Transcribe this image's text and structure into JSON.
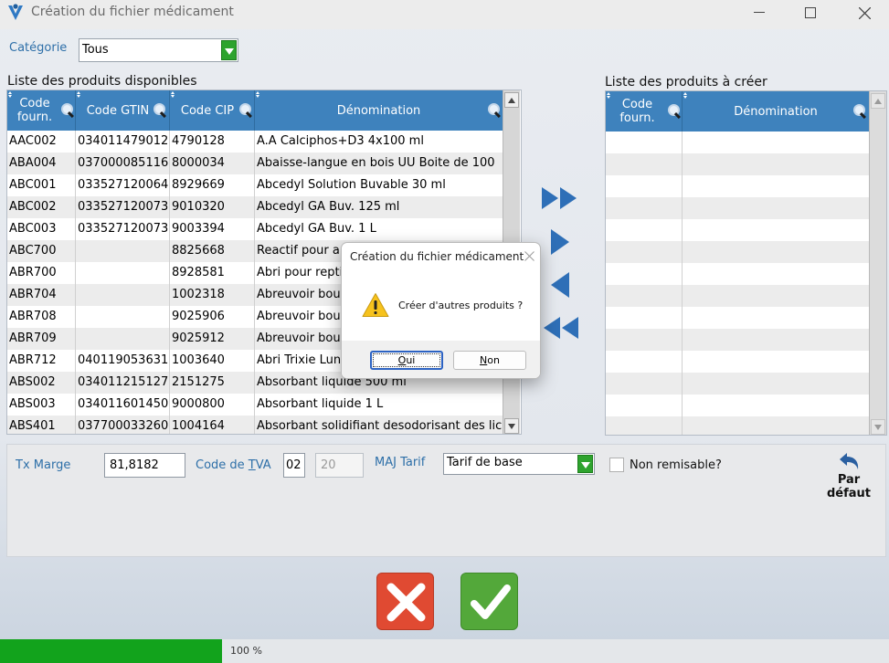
{
  "window": {
    "title": "Création du fichier médicament",
    "minimize_icon": "minimize-icon",
    "maximize_icon": "maximize-icon",
    "close_icon": "close-icon"
  },
  "category": {
    "label": "Catégorie",
    "value": "Tous"
  },
  "available": {
    "title": "Liste des produits disponibles",
    "headers": [
      "Code fourn.",
      "Code GTIN",
      "Code CIP",
      "Dénomination"
    ],
    "rows": [
      [
        "AAC002",
        "034011479012",
        "4790128",
        "A.A Calciphos+D3 4x100 ml"
      ],
      [
        "ABA004",
        "037000085116",
        "8000034",
        "Abaisse-langue en bois UU Boite de 100"
      ],
      [
        "ABC001",
        "033527120064",
        "8929669",
        "Abcedyl Solution Buvable 30 ml"
      ],
      [
        "ABC002",
        "033527120073",
        "9010320",
        "Abcedyl GA Buv. 125 ml"
      ],
      [
        "ABC003",
        "033527120073",
        "9003394",
        "Abcedyl GA Buv. 1 L"
      ],
      [
        "ABC700",
        "",
        "8825668",
        "Reactif pour a"
      ],
      [
        "ABR700",
        "",
        "8928581",
        "Abri pour repti"
      ],
      [
        "ABR704",
        "",
        "1002318",
        "Abreuvoir bout"
      ],
      [
        "ABR708",
        "",
        "9025906",
        "Abreuvoir bout"
      ],
      [
        "ABR709",
        "",
        "9025912",
        "Abreuvoir bout"
      ],
      [
        "ABR712",
        "040119053631",
        "1003640",
        "Abri Trixie Luna"
      ],
      [
        "ABS002",
        "034011215127",
        "2151275",
        "Absorbant liquide 500 ml"
      ],
      [
        "ABS003",
        "034011601450",
        "9000800",
        "Absorbant liquide 1 L"
      ],
      [
        "ABS401",
        "037700033260",
        "1004164",
        "Absorbant solidifiant desodorisant des lic"
      ]
    ]
  },
  "tocreate": {
    "title": "Liste des produits à créer",
    "headers": [
      "Code fourn.",
      "Dénomination"
    ],
    "row_count": 14
  },
  "form": {
    "tx_marge_label": "Tx Marge",
    "tx_marge_value": "81,8182",
    "tva_label_pre": "Code de ",
    "tva_label_u": "T",
    "tva_label_post": "VA",
    "tva_code": "02",
    "tva_rate": "20",
    "maj_tarif_label": "MAJ Tarif",
    "maj_tarif_value": "Tarif de base",
    "non_remisable_label": "Non remisable?",
    "par_defaut_line1": "Par",
    "par_defaut_line2": "défaut"
  },
  "progress": {
    "value": 0.25,
    "text": "100 %"
  },
  "dialog": {
    "title": "Création du fichier médicament",
    "message": "Créer d'autres produits ?",
    "yes_u": "O",
    "yes_rest": "ui",
    "no_u": "N",
    "no_rest": "on",
    "icon": "warning-icon"
  },
  "colors": {
    "accent": "#3e82bd",
    "label": "#2d6fa8",
    "progress": "#12a31c",
    "cancel": "#e04a32",
    "validate": "#53a83a"
  }
}
